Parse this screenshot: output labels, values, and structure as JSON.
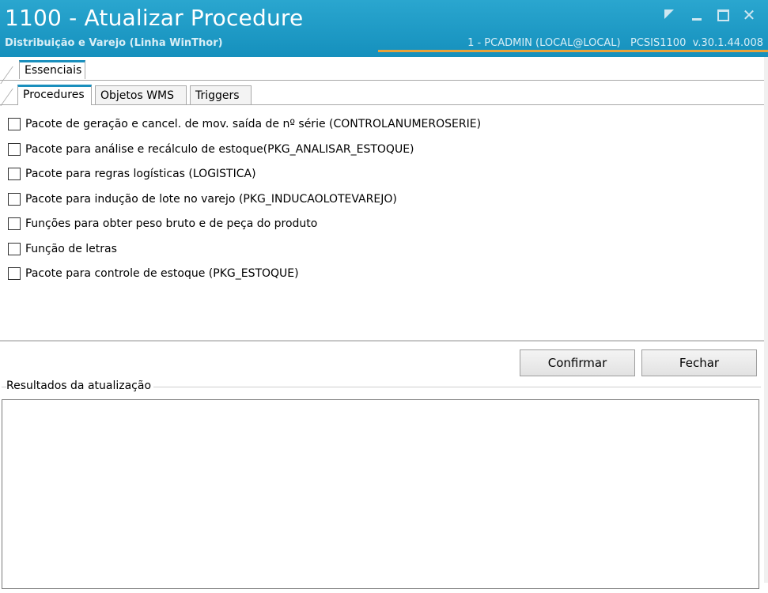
{
  "window": {
    "title": "1100 - Atualizar Procedure",
    "subtitle": "Distribuição e Varejo (Linha WinThor)",
    "user_info": "1 - PCADMIN (LOCAL@LOCAL)   PCSIS1100  v.30.1.44.008",
    "controls": [
      "restore-icon",
      "minimize-icon",
      "maximize-icon",
      "close-icon"
    ],
    "accent_color": "#1a8fbd",
    "highlight_color": "#e8a23a"
  },
  "tabs_level1": [
    {
      "label": "Essenciais",
      "active": true
    }
  ],
  "tabs_level2": [
    {
      "label": "Procedures",
      "active": true
    },
    {
      "label": "Objetos WMS",
      "active": false
    },
    {
      "label": "Triggers",
      "active": false
    }
  ],
  "procedures": [
    {
      "label": "Pacote de geração e cancel. de mov. saída de nº série (CONTROLANUMEROSERIE)",
      "checked": false
    },
    {
      "label": "Pacote para análise e recálculo de estoque(PKG_ANALISAR_ESTOQUE)",
      "checked": false
    },
    {
      "label": "Pacote para regras logísticas (LOGISTICA)",
      "checked": false
    },
    {
      "label": "Pacote para indução de lote no varejo (PKG_INDUCAOLOTEVAREJO)",
      "checked": false
    },
    {
      "label": "Funções para obter peso bruto e de peça do produto",
      "checked": false
    },
    {
      "label": "Função de letras",
      "checked": false
    },
    {
      "label": "Pacote para controle de estoque (PKG_ESTOQUE)",
      "checked": false
    }
  ],
  "buttons": {
    "confirm": "Confirmar",
    "close": "Fechar"
  },
  "results": {
    "label": "Resultados da atualização",
    "content": ""
  }
}
